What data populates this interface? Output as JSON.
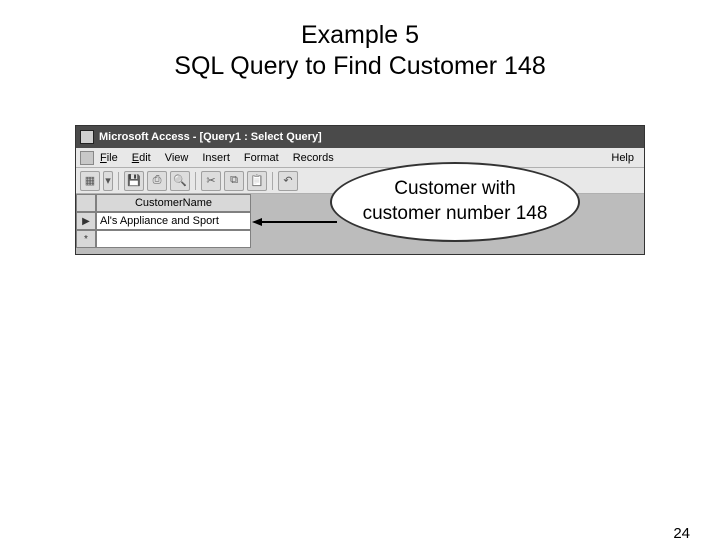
{
  "title_line1": "Example 5",
  "title_line2": "SQL Query to Find Customer 148",
  "window": {
    "title": "Microsoft Access - [Query1 : Select Query]"
  },
  "menu": {
    "file": "File",
    "edit": "Edit",
    "view": "View",
    "insert": "Insert",
    "format": "Format",
    "records": "Records",
    "help": "Help"
  },
  "grid": {
    "column_header": "CustomerName",
    "row1_value": "Al's Appliance and Sport",
    "current_marker": "▶",
    "new_marker": "*"
  },
  "callout": {
    "line1": "Customer with",
    "line2": "customer number 148"
  },
  "page_number": "24"
}
